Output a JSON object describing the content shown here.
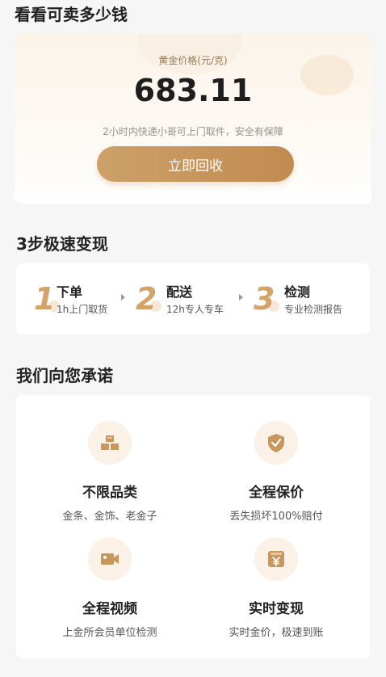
{
  "page": {
    "title": "看看可卖多少钱"
  },
  "price_card": {
    "label": "黄金价格(元/克)",
    "value": "683.11",
    "note": "2小时内快递小哥可上门取件，安全有保障",
    "button_label": "立即回收"
  },
  "steps": {
    "title": "3步极速变现",
    "items": [
      {
        "num": "1",
        "name": "下单",
        "desc": "1h上门取货"
      },
      {
        "num": "2",
        "name": "配送",
        "desc": "12h专人专车"
      },
      {
        "num": "3",
        "name": "检测",
        "desc": "专业检测报告"
      }
    ]
  },
  "promises": {
    "title": "我们向您承诺",
    "items": [
      {
        "icon": "gold-bars-icon",
        "title": "不限品类",
        "desc": "金条、金饰、老金子"
      },
      {
        "icon": "shield-check-icon",
        "title": "全程保价",
        "desc": "丢失损坏100%赔付"
      },
      {
        "icon": "video-camera-icon",
        "title": "全程视频",
        "desc": "上金所会员单位检测"
      },
      {
        "icon": "wallet-yuan-icon",
        "title": "实时变现",
        "desc": "实时金价，极速到账"
      }
    ]
  },
  "colors": {
    "accent": "#c8975e",
    "accent_light": "#fbf1e6",
    "background": "#f6f6f6"
  }
}
